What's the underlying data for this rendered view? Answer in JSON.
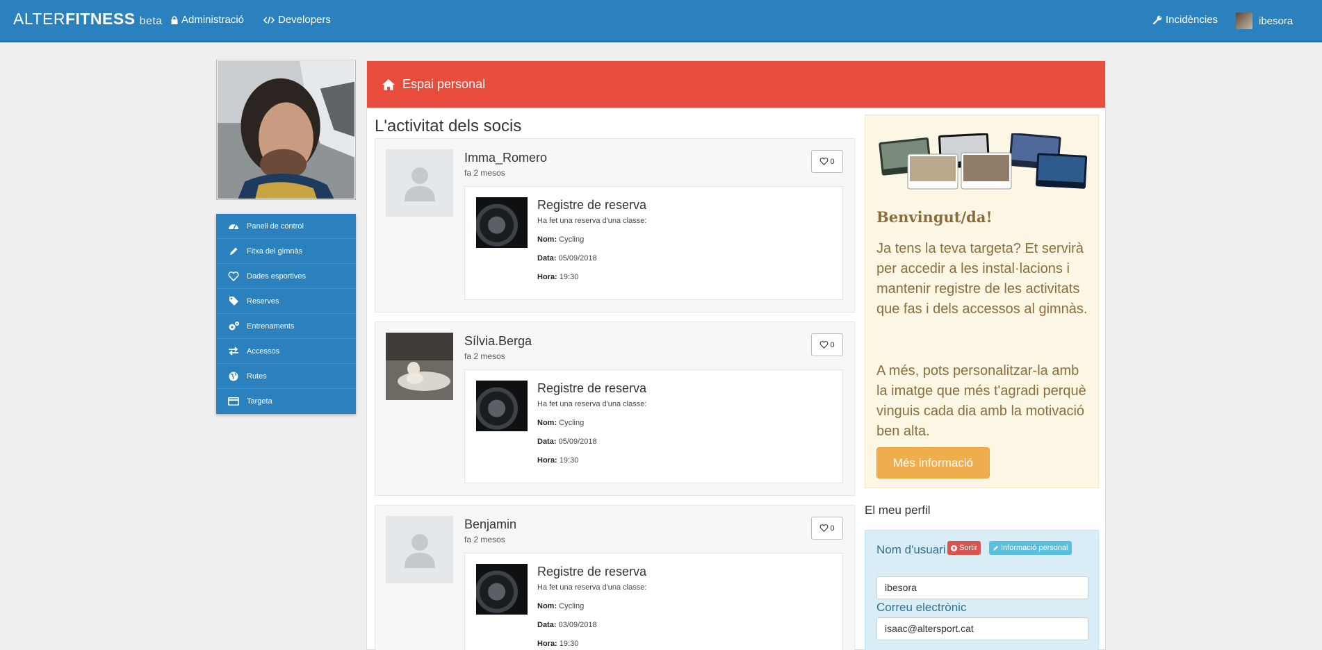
{
  "navbar": {
    "brand_light": "ALTER",
    "brand_bold": "FITNESS",
    "brand_tag": "beta",
    "admin_label": "Administració",
    "developers_label": "Developers",
    "incidences_label": "Incidències",
    "user_label": "ibesora"
  },
  "sidebar": {
    "items": [
      {
        "label": "Panell de control",
        "icon": "dashboard-icon"
      },
      {
        "label": "Fitxa del gimnàs",
        "icon": "pencil-icon"
      },
      {
        "label": "Dades esportives",
        "icon": "heart-icon"
      },
      {
        "label": "Reserves",
        "icon": "tag-icon"
      },
      {
        "label": "Entrenaments",
        "icon": "gears-icon"
      },
      {
        "label": "Accessos",
        "icon": "exchange-icon"
      },
      {
        "label": "Rutes",
        "icon": "globe-icon"
      },
      {
        "label": "Targeta",
        "icon": "credit-card-icon"
      }
    ]
  },
  "panel": {
    "title": "Espai personal",
    "feed_title": "L'activitat dels socis"
  },
  "feed": [
    {
      "user": "Imma_Romero",
      "time": "fa 2 mesos",
      "likes": "0",
      "title": "Registre de reserva",
      "subtitle": "Ha fet una reserva d'una classe:",
      "nom_label": "Nom:",
      "nom": "Cycling",
      "data_label": "Data:",
      "data": "05/09/2018",
      "hora_label": "Hora:",
      "hora": "19:30"
    },
    {
      "user": "Sílvia.Berga",
      "time": "fa 2 mesos",
      "likes": "0",
      "title": "Registre de reserva",
      "subtitle": "Ha fet una reserva d'una classe:",
      "nom_label": "Nom:",
      "nom": "Cycling",
      "data_label": "Data:",
      "data": "05/09/2018",
      "hora_label": "Hora:",
      "hora": "19:30"
    },
    {
      "user": "Benjamin",
      "time": "fa 2 mesos",
      "likes": "0",
      "title": "Registre de reserva",
      "subtitle": "Ha fet una reserva d'una classe:",
      "nom_label": "Nom:",
      "nom": "Cycling",
      "data_label": "Data:",
      "data": "03/09/2018",
      "hora_label": "Hora:",
      "hora": "19:30"
    }
  ],
  "welcome": {
    "title": "Benvingut/da!",
    "p1": "Ja tens la teva targeta? Et servirà per accedir a les instal·lacions i mantenir registre de les activitats que fas i dels accessos al gimnàs.",
    "p2": "A més, pots personalitzar-la amb la imatge que més t'agradi perquè vinguis cada dia amb la motivació ben alta.",
    "button": "Més informació"
  },
  "profile": {
    "title": "El meu perfil",
    "logout_label": "Sortir",
    "info_label": "Informació personal",
    "username_label": "Nom d'usuari",
    "username_value": "ibesora",
    "email_label": "Correu electrònic",
    "email_value": "isaac@altersport.cat"
  },
  "colors": {
    "navbar": "#2a81bd",
    "panel_header": "#e84c3d",
    "warning_button": "#f0ad4e",
    "logout_button": "#d9534f",
    "info_button": "#5bc0de"
  }
}
